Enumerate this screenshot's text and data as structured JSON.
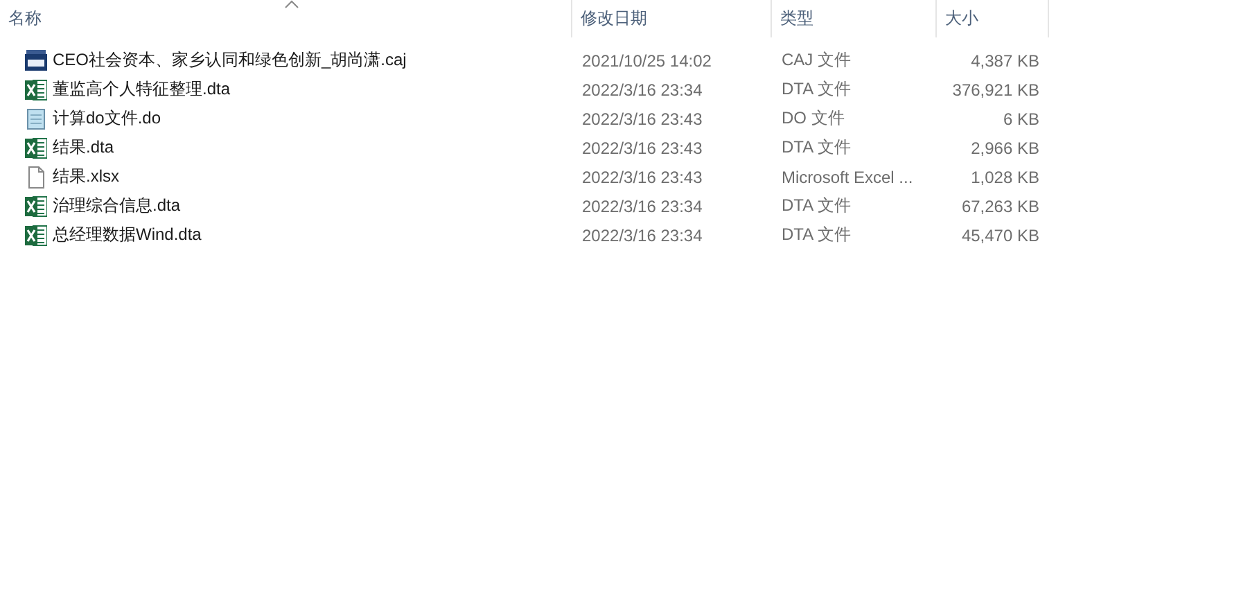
{
  "columns": [
    {
      "label": "名称",
      "sorted": true
    },
    {
      "label": "修改日期",
      "sorted": false
    },
    {
      "label": "类型",
      "sorted": false
    },
    {
      "label": "大小",
      "sorted": false
    }
  ],
  "rows": [
    {
      "kind": "caj",
      "name": "CEO社会资本、家乡认同和绿色创新_胡尚潇.caj",
      "date": "2021/10/25 14:02",
      "type": "CAJ 文件",
      "size": "4,387 KB"
    },
    {
      "kind": "excel",
      "name": "董监高个人特征整理.dta",
      "date": "2022/3/16 23:34",
      "type": "DTA 文件",
      "size": "376,921 KB"
    },
    {
      "kind": "notepad",
      "name": "计算do文件.do",
      "date": "2022/3/16 23:43",
      "type": "DO 文件",
      "size": "6 KB"
    },
    {
      "kind": "excel",
      "name": "结果.dta",
      "date": "2022/3/16 23:43",
      "type": "DTA 文件",
      "size": "2,966 KB"
    },
    {
      "kind": "blank",
      "name": "结果.xlsx",
      "date": "2022/3/16 23:43",
      "type": "Microsoft Excel ...",
      "size": "1,028 KB"
    },
    {
      "kind": "excel",
      "name": "治理综合信息.dta",
      "date": "2022/3/16 23:34",
      "type": "DTA 文件",
      "size": "67,263 KB"
    },
    {
      "kind": "excel",
      "name": "总经理数据Wind.dta",
      "date": "2022/3/16 23:34",
      "type": "DTA 文件",
      "size": "45,470 KB"
    }
  ]
}
